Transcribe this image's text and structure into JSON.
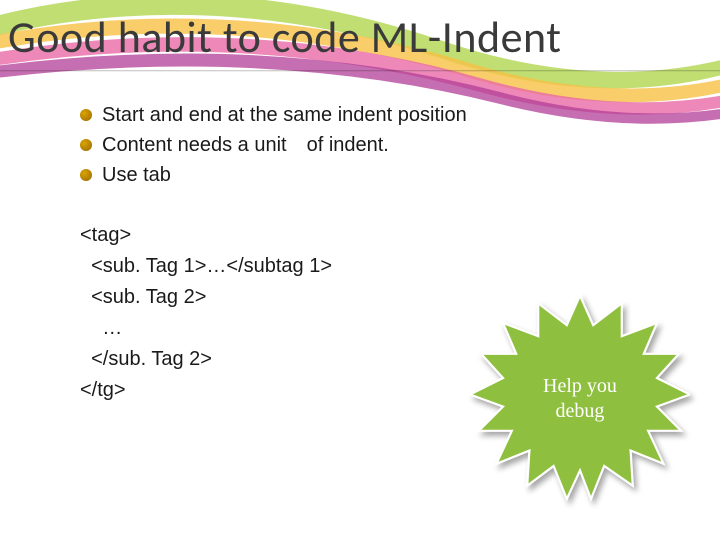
{
  "title": "Good habit to code ML-Indent",
  "bullets": [
    "Start and end at the same indent position",
    "Content needs a unit of indent.",
    "Use tab"
  ],
  "code": {
    "l1": "<tag>",
    "l2": "  <sub. Tag 1>…</subtag 1>",
    "l3": "  <sub. Tag 2>",
    "l4": "    …",
    "l5": "  </sub. Tag 2>",
    "l6": "</tg>"
  },
  "burst": {
    "line1": "Help  you",
    "line2": "debug"
  }
}
